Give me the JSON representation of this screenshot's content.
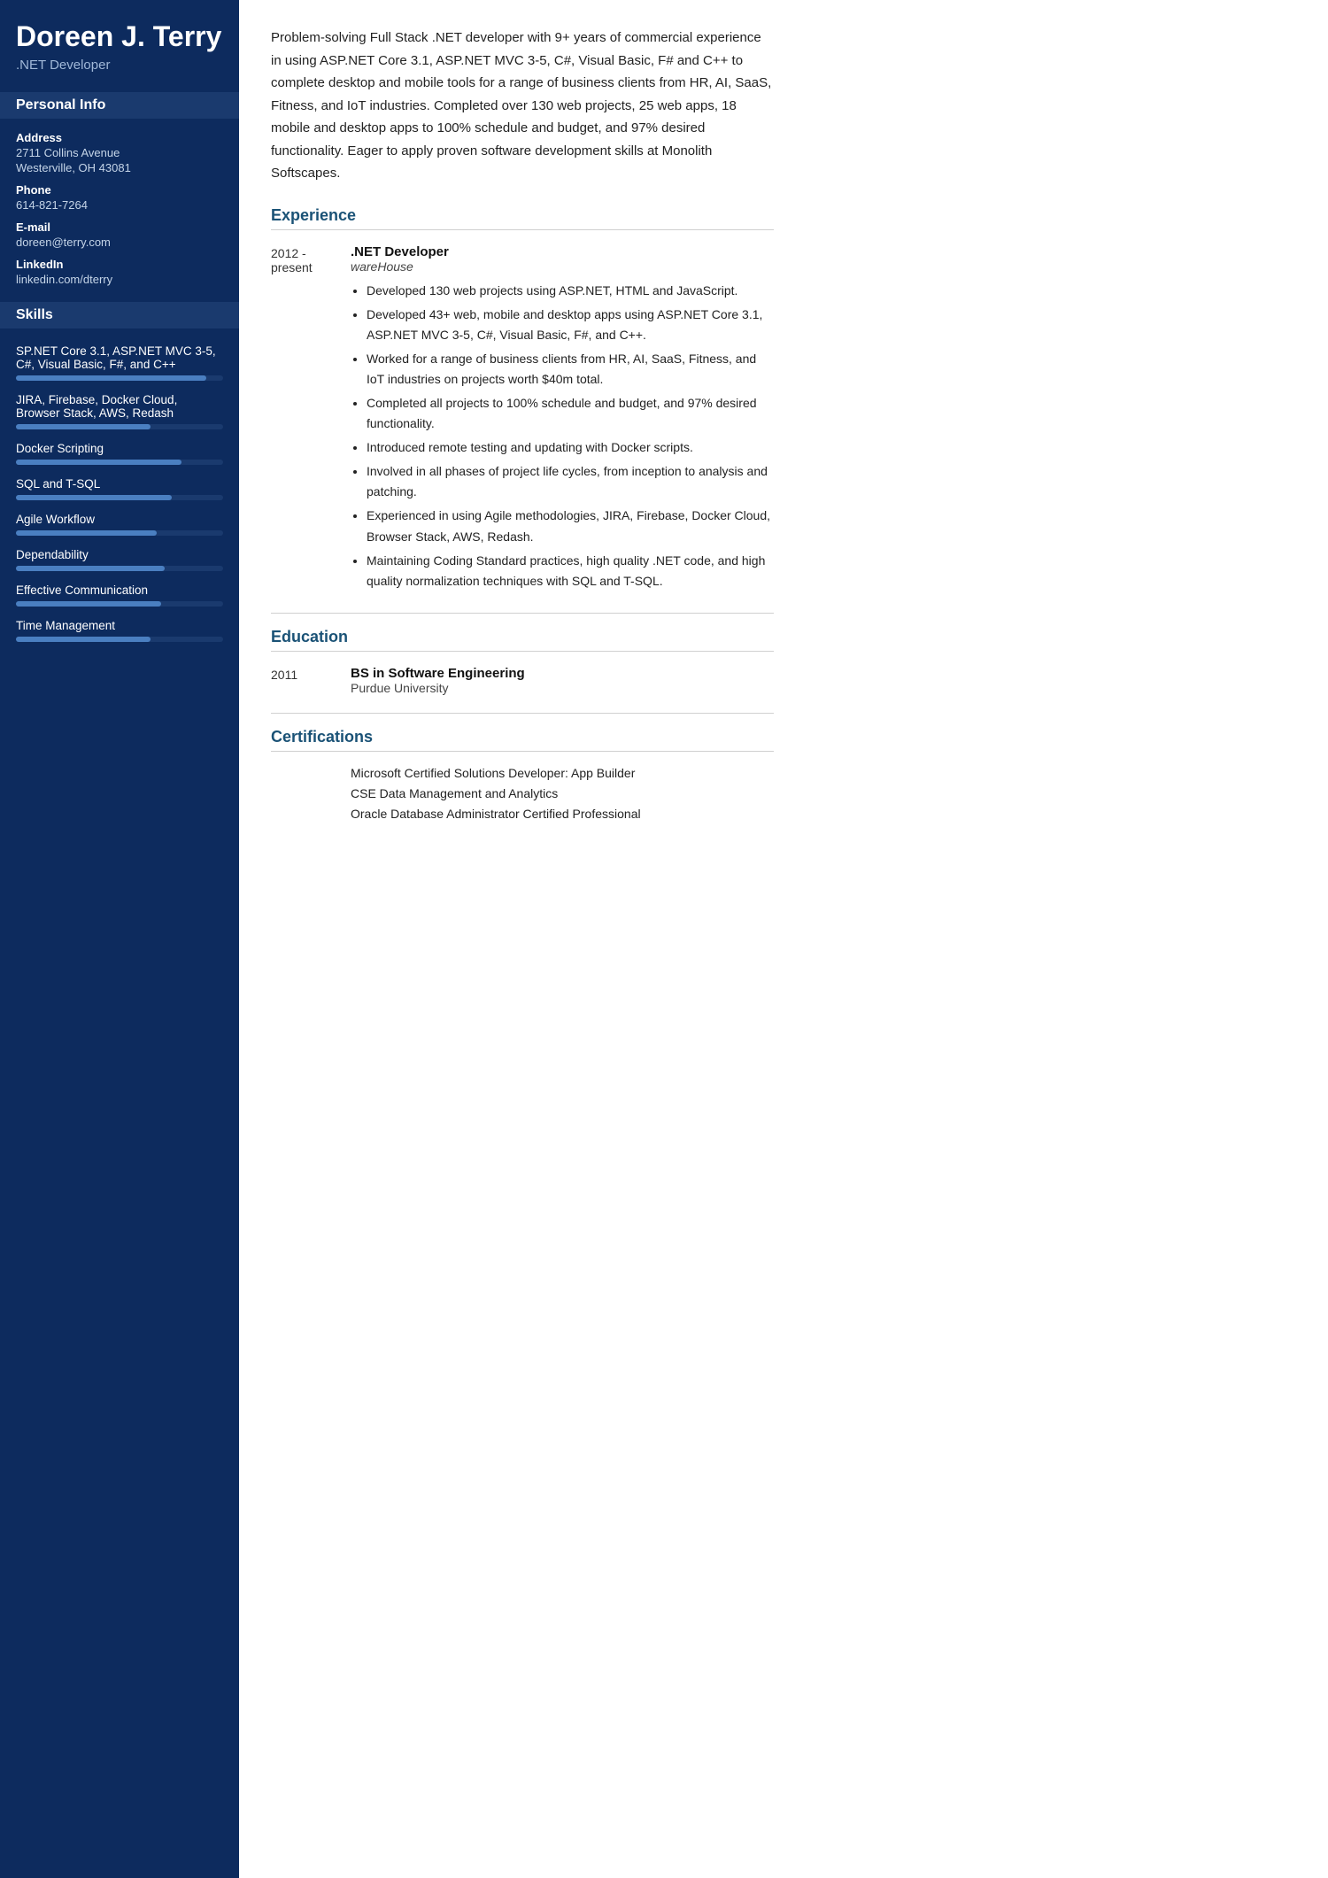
{
  "sidebar": {
    "name": "Doreen J. Terry",
    "title": ".NET Developer",
    "sections": {
      "personal_info_label": "Personal Info",
      "contact": {
        "address_label": "Address",
        "address_line1": "2711 Collins Avenue",
        "address_line2": "Westerville, OH 43081",
        "phone_label": "Phone",
        "phone_value": "614-821-7264",
        "email_label": "E-mail",
        "email_value": "doreen@terry.com",
        "linkedin_label": "LinkedIn",
        "linkedin_value": "linkedin.com/dterry"
      },
      "skills_label": "Skills",
      "skills": [
        {
          "name": "SP.NET Core 3.1, ASP.NET MVC 3-5, C#, Visual Basic, F#, and C++",
          "fill": 92
        },
        {
          "name": "JIRA, Firebase, Docker Cloud, Browser Stack, AWS, Redash",
          "fill": 65
        },
        {
          "name": "Docker Scripting",
          "fill": 80
        },
        {
          "name": "SQL and T-SQL",
          "fill": 75
        },
        {
          "name": "Agile Workflow",
          "fill": 68
        },
        {
          "name": "Dependability",
          "fill": 72
        },
        {
          "name": "Effective Communication",
          "fill": 70
        },
        {
          "name": "Time Management",
          "fill": 65
        }
      ]
    }
  },
  "main": {
    "summary": "Problem-solving Full Stack .NET developer with 9+ years of commercial experience in using ASP.NET Core 3.1, ASP.NET MVC 3-5, C#, Visual Basic, F# and C++ to complete desktop and mobile tools for a range of business clients from HR, AI, SaaS, Fitness, and IoT industries. Completed over 130 web projects, 25 web apps, 18 mobile and desktop apps to 100% schedule and budget, and 97% desired functionality. Eager to apply proven software development skills at Monolith Softscapes.",
    "experience_label": "Experience",
    "experience": [
      {
        "date": "2012 - present",
        "job_title": ".NET Developer",
        "company": "wareHouse",
        "bullets": [
          "Developed 130 web projects using ASP.NET, HTML and JavaScript.",
          "Developed 43+ web, mobile and desktop apps using ASP.NET Core 3.1, ASP.NET MVC 3-5, C#, Visual Basic, F#, and C++.",
          "Worked for a range of business clients from HR, AI, SaaS, Fitness, and IoT industries on projects worth $40m total.",
          "Completed all projects to 100% schedule and budget, and 97% desired functionality.",
          "Introduced remote testing and updating with Docker scripts.",
          "Involved in all phases of project life cycles, from inception to analysis and patching.",
          "Experienced in using Agile methodologies, JIRA, Firebase, Docker Cloud, Browser Stack, AWS, Redash.",
          "Maintaining Coding Standard practices, high quality .NET code, and high quality normalization techniques with SQL and T-SQL."
        ]
      }
    ],
    "education_label": "Education",
    "education": [
      {
        "date": "2011",
        "degree": "BS in Software Engineering",
        "school": "Purdue University"
      }
    ],
    "certifications_label": "Certifications",
    "certifications": [
      "Microsoft Certified Solutions Developer: App Builder",
      "CSE Data Management and Analytics",
      "Oracle Database Administrator Certified Professional"
    ]
  }
}
